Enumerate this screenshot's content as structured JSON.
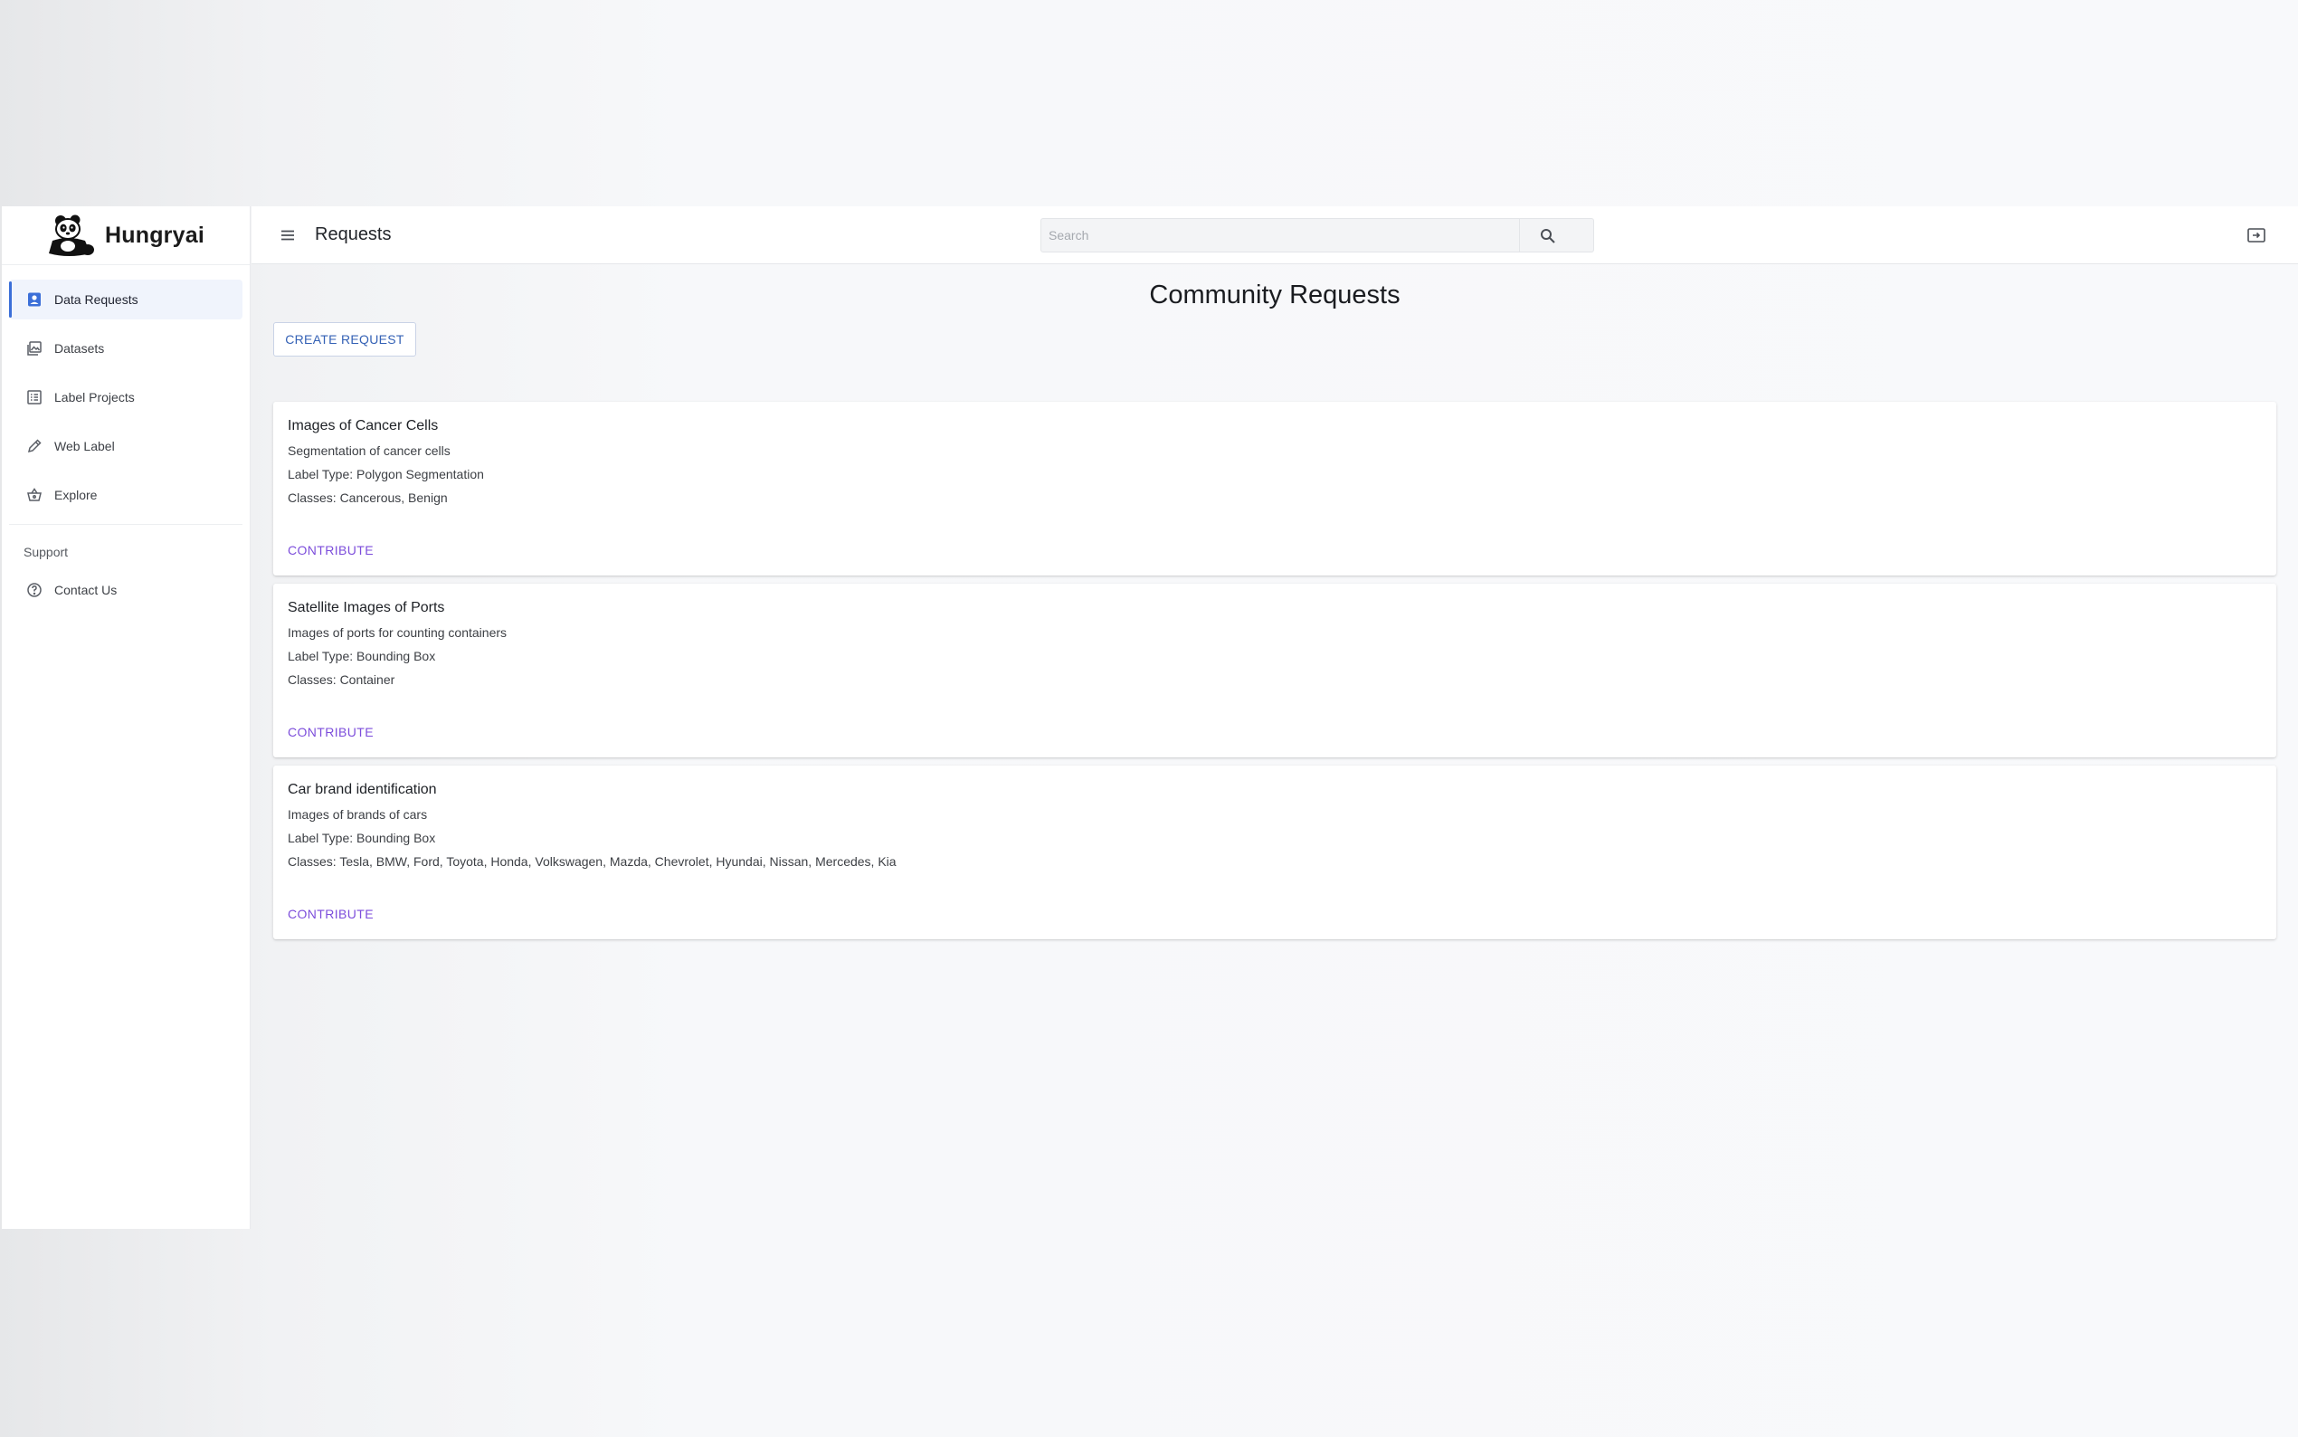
{
  "app": {
    "brand": "Hungryai",
    "page_title": "Requests"
  },
  "sidebar": {
    "items": [
      {
        "label": "Data Requests",
        "icon": "person-badge-icon",
        "active": true
      },
      {
        "label": "Datasets",
        "icon": "image-stack-icon"
      },
      {
        "label": "Label Projects",
        "icon": "list-icon"
      },
      {
        "label": "Web Label",
        "icon": "pencil-icon"
      },
      {
        "label": "Explore",
        "icon": "basket-icon"
      }
    ],
    "support_label": "Support",
    "support_items": [
      {
        "label": "Contact Us",
        "icon": "help-circle-icon"
      }
    ]
  },
  "header": {
    "search_placeholder": "Search"
  },
  "main": {
    "heading": "Community Requests",
    "create_button": "CREATE REQUEST",
    "requests": [
      {
        "title": "Images of Cancer Cells",
        "description": "Segmentation of cancer cells",
        "label_type": "Label Type: Polygon Segmentation",
        "classes": "Classes: Cancerous, Benign",
        "action": "CONTRIBUTE"
      },
      {
        "title": "Satellite Images of Ports",
        "description": "Images of ports for counting containers",
        "label_type": "Label Type: Bounding Box",
        "classes": "Classes: Container",
        "action": "CONTRIBUTE"
      },
      {
        "title": "Car brand identification",
        "description": "Images of brands of cars",
        "label_type": "Label Type: Bounding Box",
        "classes": "Classes: Tesla, BMW, Ford, Toyota, Honda, Volkswagen, Mazda, Chevrolet, Hyundai, Nissan, Mercedes, Kia",
        "action": "CONTRIBUTE"
      }
    ]
  },
  "colors": {
    "accent_blue": "#3b6fd8",
    "contribute_purple": "#7c4ddb"
  }
}
